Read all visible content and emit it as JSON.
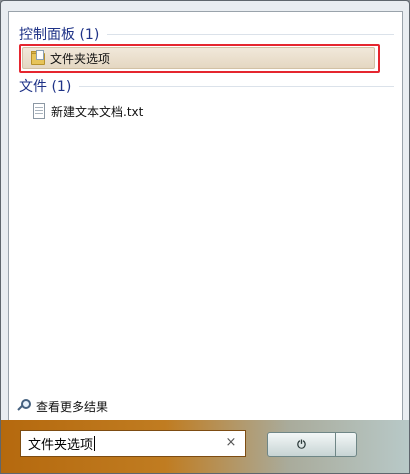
{
  "groups": {
    "control_panel": {
      "title": "控制面板 (1)",
      "items": [
        {
          "label": "文件夹选项",
          "icon": "folder-options-icon",
          "selected": true
        }
      ]
    },
    "files": {
      "title": "文件 (1)",
      "items": [
        {
          "label": "新建文本文档.txt",
          "icon": "text-document-icon"
        }
      ]
    }
  },
  "see_more": {
    "label": "查看更多结果",
    "icon": "search-icon"
  },
  "search": {
    "value": "文件夹选项",
    "clear_label": "×"
  },
  "colors": {
    "group_header": "#1e3287",
    "highlight_border": "#e5262f",
    "bottom_bar": "#b5690e"
  }
}
